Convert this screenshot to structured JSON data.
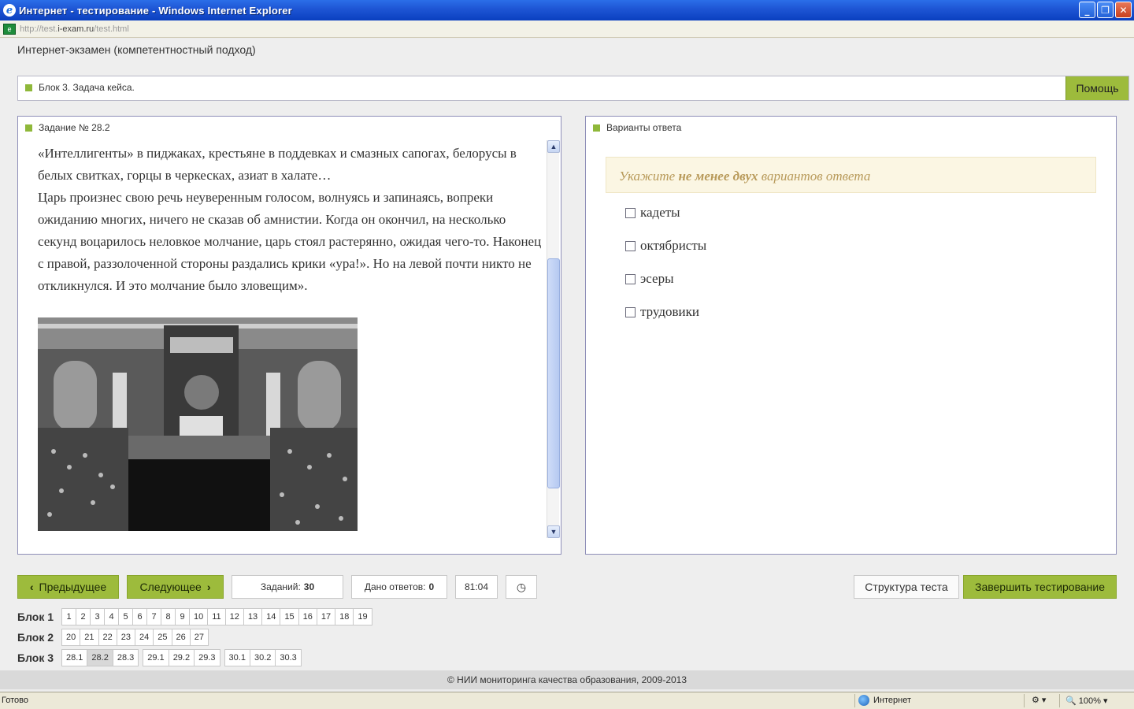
{
  "window": {
    "title": "Интернет - тестирование - Windows Internet Explorer",
    "url_prefix": "http://test.",
    "url_domain": "i-exam.ru",
    "url_suffix": "/test.html"
  },
  "page": {
    "exam_title": "Интернет-экзамен (компетентностный подход)",
    "block_label": "Блок 3. Задача кейса.",
    "help_label": "Помощь"
  },
  "task": {
    "header": "Задание № 28.2",
    "text": "«Интеллигенты» в пиджаках, крестьяне в поддевках и смазных сапогах, белорусы в белых свитках, горцы в черкесках, азиат в халате…\nЦарь произнес свою речь неуверенным голосом, волнуясь и запинаясь, вопреки ожиданию многих, ничего не сказав об амнистии. Когда он окончил, на несколько секунд воцарилось неловкое молчание, царь стоял растерянно, ожидая чего-то. Наконец с правой, раззолоченной стороны раздались крики «ура!». Но на левой почти никто не откликнулся. И это молчание было зловещим»."
  },
  "answers": {
    "header": "Варианты ответа",
    "instruction_pre": "Укажите ",
    "instruction_bold": "не менее двух",
    "instruction_post": " вариантов ответа",
    "options": [
      "кадеты",
      "октябристы",
      "эсеры",
      "трудовики"
    ]
  },
  "controls": {
    "prev_label": "Предыдущее",
    "next_label": "Следующее",
    "tasks_label": "Заданий:",
    "tasks_count": "30",
    "answered_label": "Дано ответов:",
    "answered_count": "0",
    "timer": "81:04",
    "structure_label": "Структура теста",
    "finish_label": "Завершить тестирование"
  },
  "blocks": {
    "b1_label": "Блок 1",
    "b1": [
      "1",
      "2",
      "3",
      "4",
      "5",
      "6",
      "7",
      "8",
      "9",
      "10",
      "11",
      "12",
      "13",
      "14",
      "15",
      "16",
      "17",
      "18",
      "19"
    ],
    "b2_label": "Блок 2",
    "b2": [
      "20",
      "21",
      "22",
      "23",
      "24",
      "25",
      "26",
      "27"
    ],
    "b3_label": "Блок 3",
    "b3_groups": [
      [
        "28.1",
        "28.2",
        "28.3"
      ],
      [
        "29.1",
        "29.2",
        "29.3"
      ],
      [
        "30.1",
        "30.2",
        "30.3"
      ]
    ],
    "active": "28.2"
  },
  "footer": "© НИИ мониторинга качества образования, 2009-2013",
  "status": {
    "left": "Готово",
    "zone": "Интернет",
    "zoom": "100%"
  },
  "colors": {
    "accent_green": "#9dbb3c",
    "panel_border": "#8e8eb8"
  }
}
